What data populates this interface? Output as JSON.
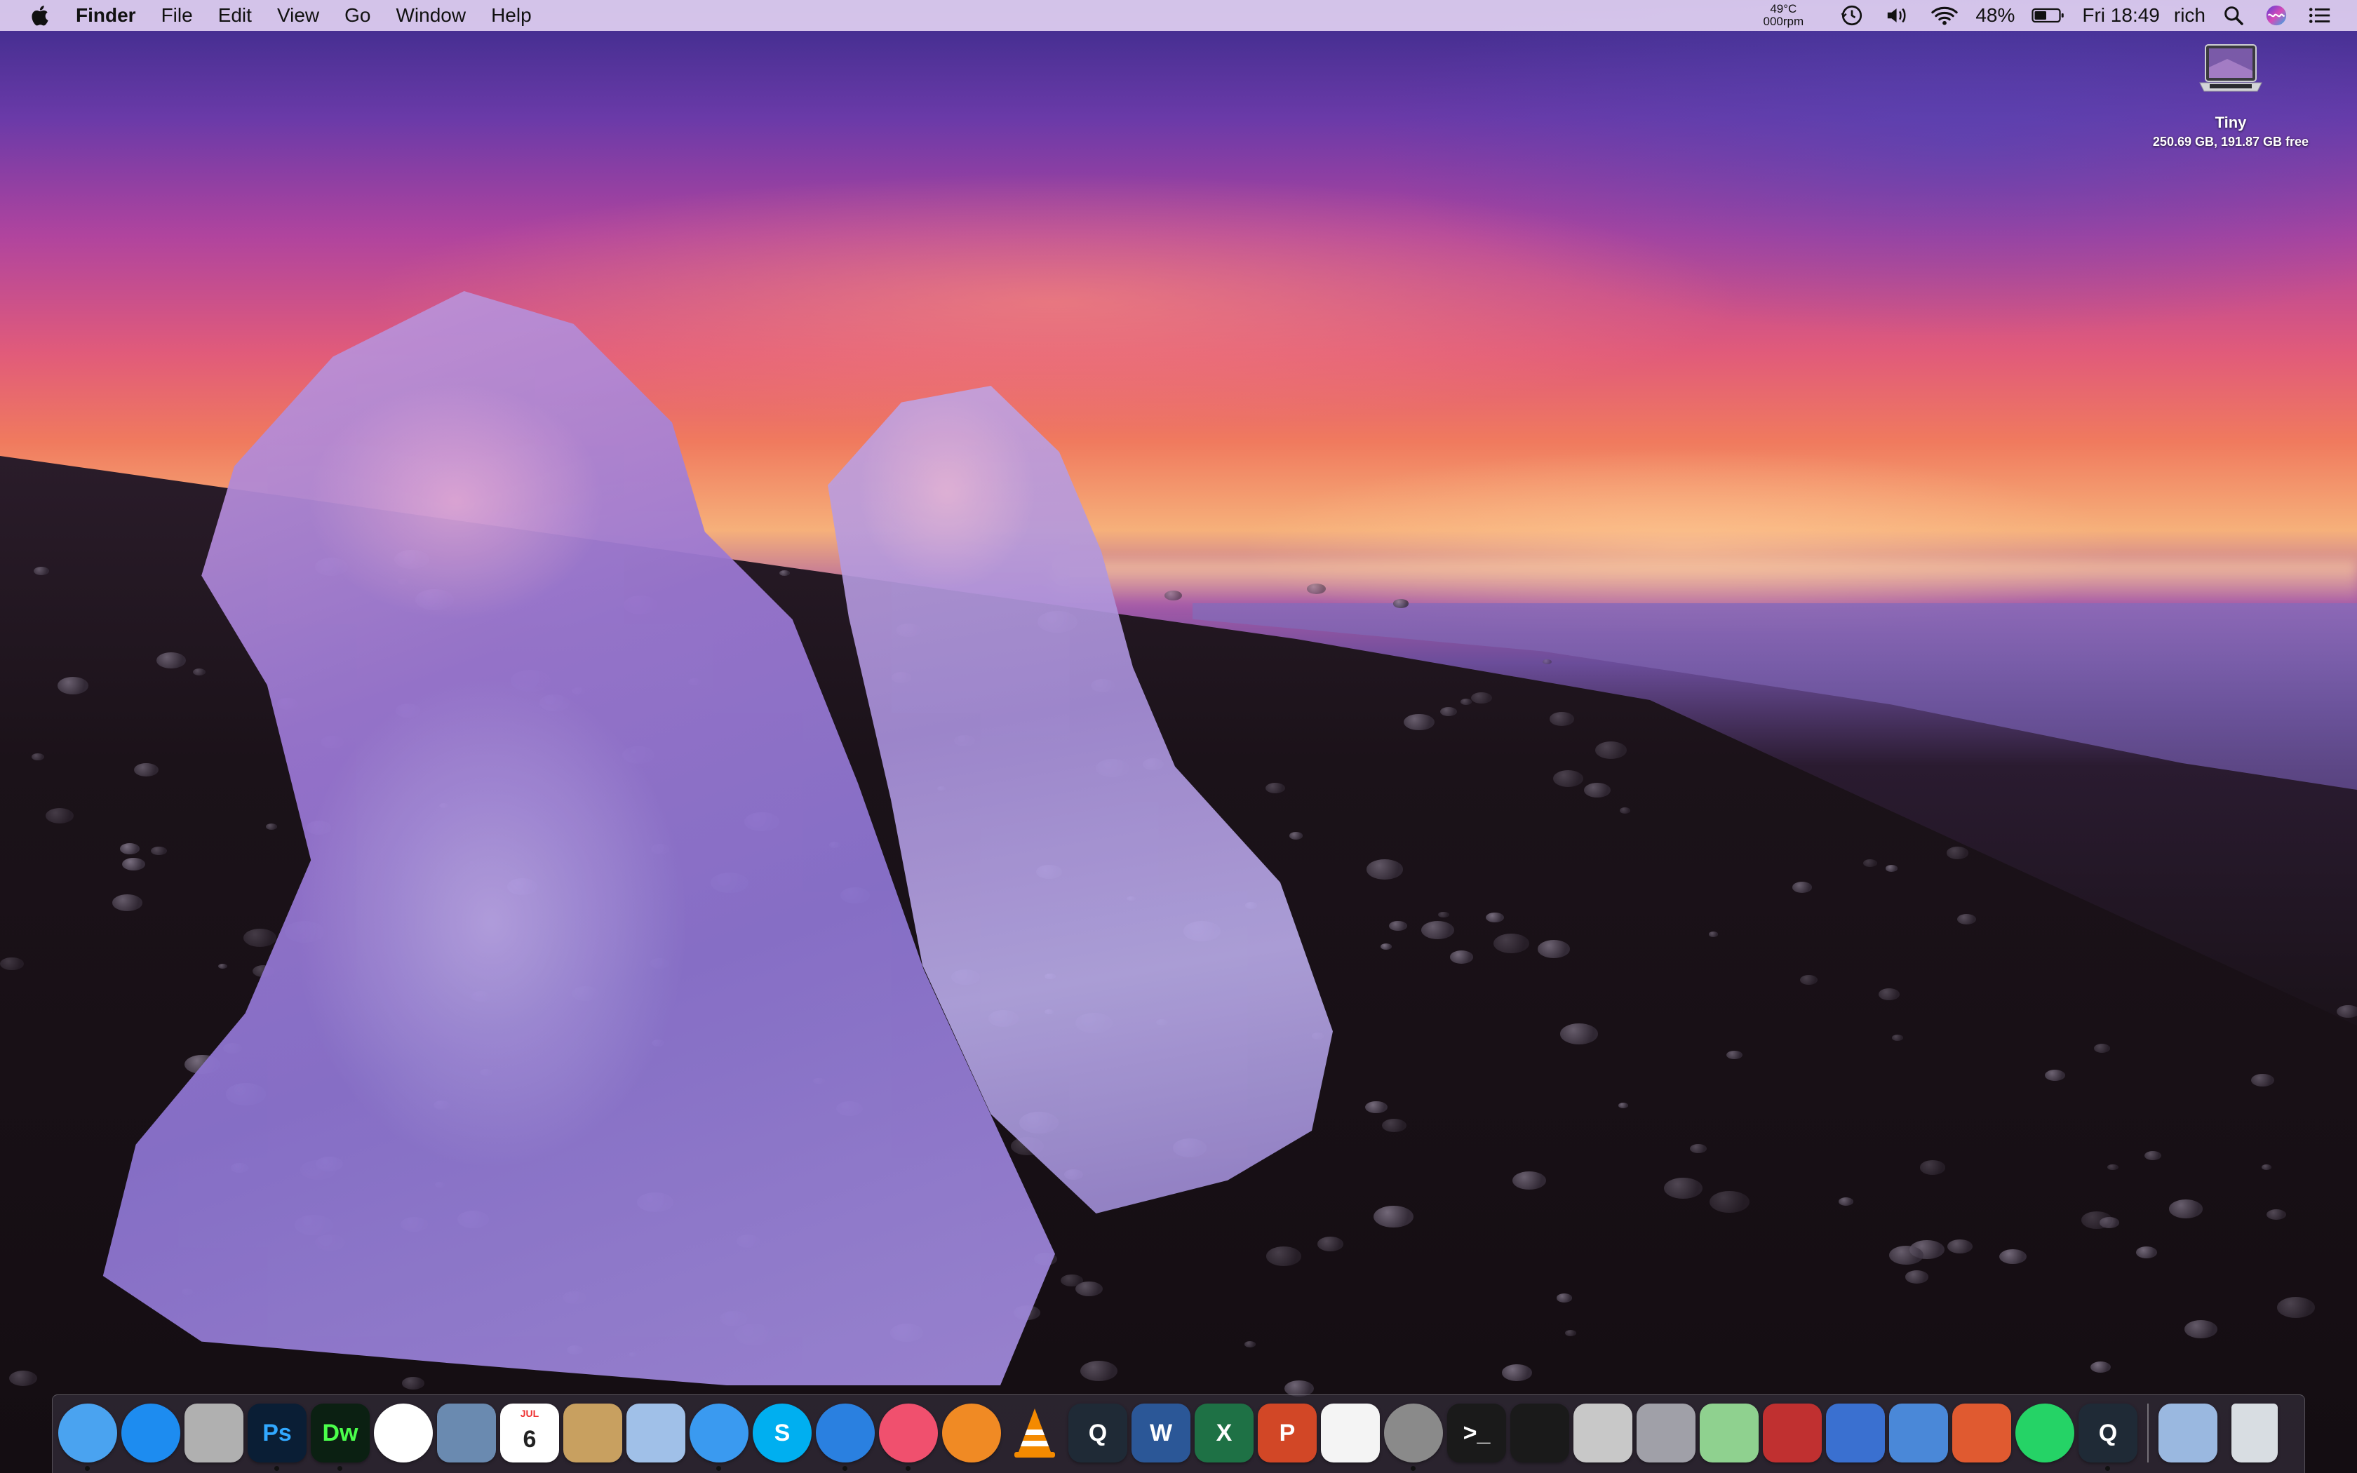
{
  "menubar": {
    "app_name": "Finder",
    "menus": [
      "File",
      "Edit",
      "View",
      "Go",
      "Window",
      "Help"
    ],
    "temp": "49°C",
    "fan": "000rpm",
    "battery": "48%",
    "clock": "Fri 18:49",
    "user": "rich",
    "icons": [
      "time-machine-icon",
      "volume-icon",
      "wifi-icon",
      "battery-icon",
      "spotlight-icon",
      "siri-icon",
      "notification-center-icon"
    ]
  },
  "desktop": {
    "drive": {
      "name": "Tiny",
      "info": "250.69 GB, 191.87 GB free"
    }
  },
  "dock": {
    "items": [
      {
        "name": "finder",
        "label": "",
        "bg": "#4aa3f0"
      },
      {
        "name": "app-store",
        "label": "",
        "bg": "#1d8cf0"
      },
      {
        "name": "calculator",
        "label": "",
        "bg": "#b0b0b0"
      },
      {
        "name": "photoshop",
        "label": "Ps",
        "bg": "#0a1e35",
        "fg": "#31a8ff"
      },
      {
        "name": "dreamweaver",
        "label": "Dw",
        "bg": "#0b2012",
        "fg": "#4bff4b"
      },
      {
        "name": "photos",
        "label": "",
        "bg": "#ffffff"
      },
      {
        "name": "preview",
        "label": "",
        "bg": "#6a8ab0"
      },
      {
        "name": "calendar",
        "label": "6",
        "sublabel": "JUL",
        "bg": "#ffffff",
        "fg": "#222"
      },
      {
        "name": "contacts",
        "label": "",
        "bg": "#c8a060"
      },
      {
        "name": "mail-sender",
        "label": "",
        "bg": "#a0c0e8"
      },
      {
        "name": "messages",
        "label": "",
        "bg": "#3a9af0"
      },
      {
        "name": "skype",
        "label": "S",
        "bg": "#00aff0"
      },
      {
        "name": "safari",
        "label": "",
        "bg": "#2a80e0"
      },
      {
        "name": "itunes",
        "label": "",
        "bg": "#f0506e"
      },
      {
        "name": "ibooks",
        "label": "",
        "bg": "#f08a24"
      },
      {
        "name": "vlc",
        "label": "",
        "bg": "transparent"
      },
      {
        "name": "quicktime",
        "label": "Q",
        "bg": "#1f2a36"
      },
      {
        "name": "word",
        "label": "W",
        "bg": "#2b5797"
      },
      {
        "name": "excel",
        "label": "X",
        "bg": "#1e7145"
      },
      {
        "name": "powerpoint",
        "label": "P",
        "bg": "#d24726"
      },
      {
        "name": "textedit",
        "label": "",
        "bg": "#f4f4f4"
      },
      {
        "name": "system-preferences",
        "label": "",
        "bg": "#8a8a8a"
      },
      {
        "name": "terminal",
        "label": ">_",
        "bg": "#1a1a1a"
      },
      {
        "name": "activity-monitor",
        "label": "",
        "bg": "#1a1a1a"
      },
      {
        "name": "disk-utility",
        "label": "",
        "bg": "#c8c8c8"
      },
      {
        "name": "automator",
        "label": "",
        "bg": "#a0a0a8"
      },
      {
        "name": "maps",
        "label": "",
        "bg": "#8fd18f"
      },
      {
        "name": "photo-booth",
        "label": "",
        "bg": "#c03030"
      },
      {
        "name": "screen-sharing",
        "label": "",
        "bg": "#3a70d0"
      },
      {
        "name": "migration-assistant",
        "label": "",
        "bg": "#4a88d8"
      },
      {
        "name": "remote-desktop",
        "label": "",
        "bg": "#e05a30"
      },
      {
        "name": "whatsapp",
        "label": "",
        "bg": "#25d366"
      },
      {
        "name": "quicktime-player",
        "label": "Q",
        "bg": "#1f2a36"
      }
    ],
    "running": [
      0,
      3,
      4,
      10,
      12,
      13,
      21,
      32
    ],
    "right_items": [
      {
        "name": "home-folder",
        "bg": "#9ab8e0"
      },
      {
        "name": "trash",
        "bg": "#d8dde2"
      }
    ]
  }
}
